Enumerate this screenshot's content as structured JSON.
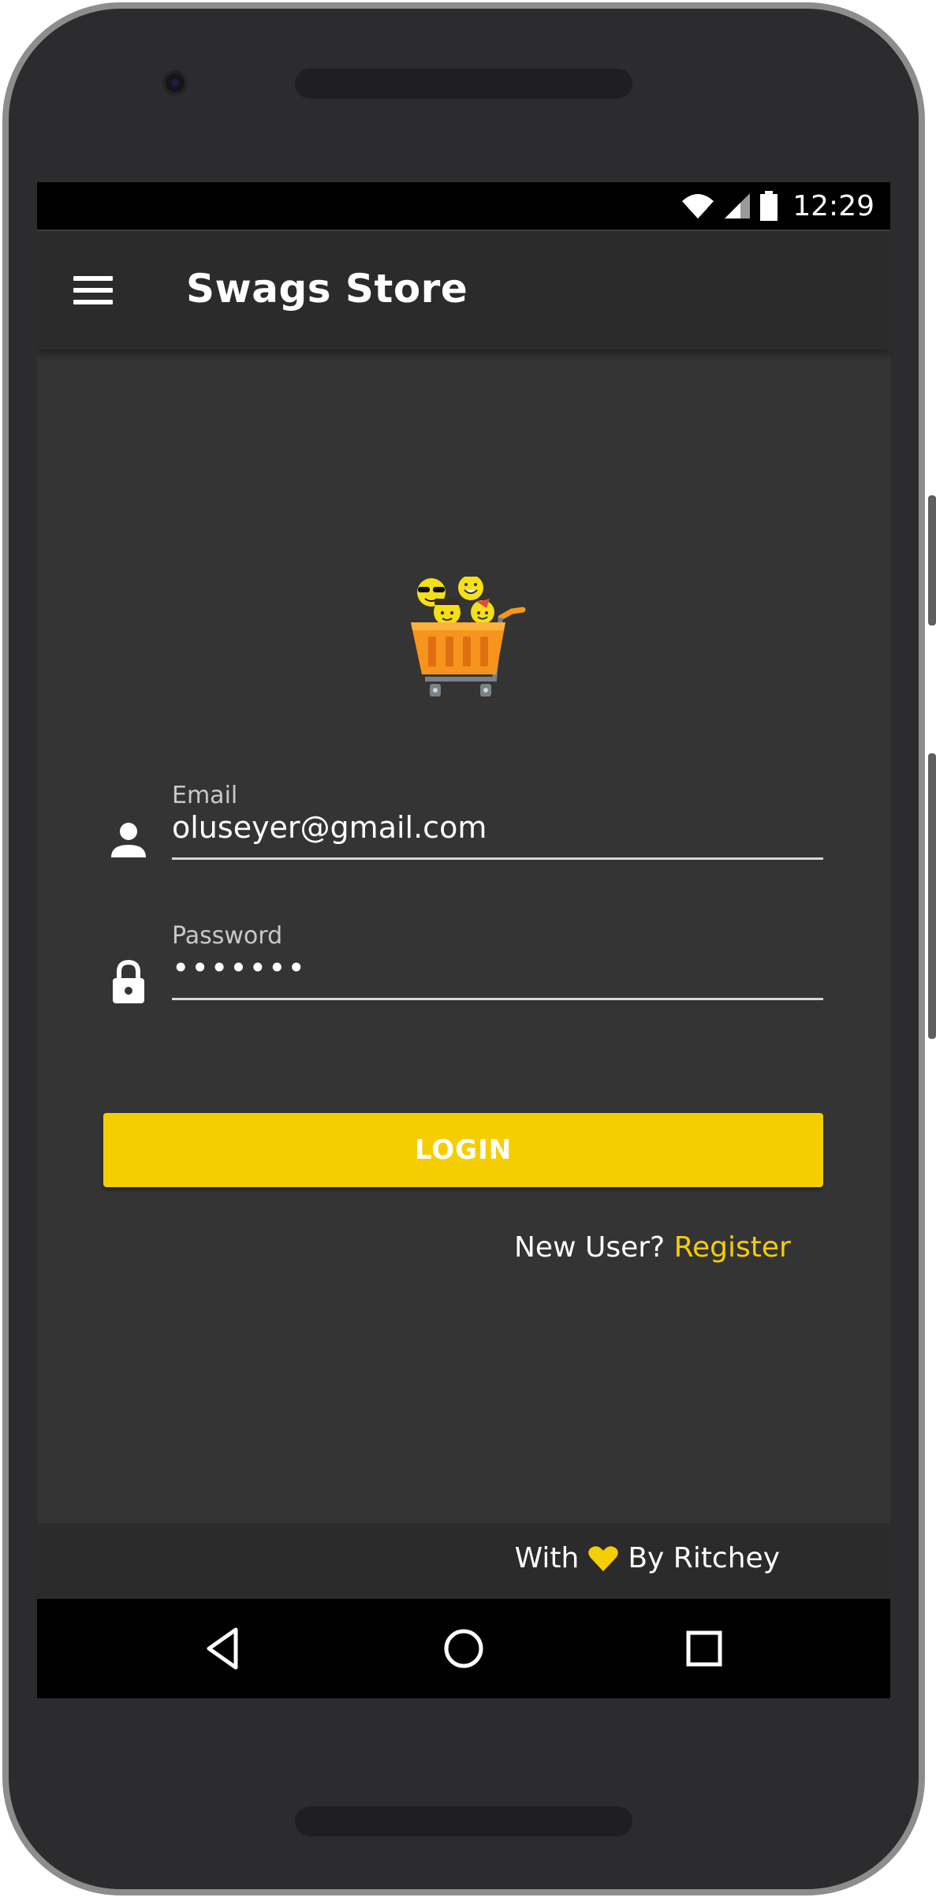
{
  "status_bar": {
    "time": "12:29",
    "icons": [
      "wifi-icon",
      "cellular-signal-icon",
      "battery-icon"
    ]
  },
  "app_bar": {
    "title": "Swags Store",
    "menu_icon": "hamburger-menu-icon"
  },
  "logo": {
    "icon": "shopping-cart-emoji-logo"
  },
  "login_form": {
    "email": {
      "label": "Email",
      "value": "oluseyer@gmail.com",
      "icon": "person-icon"
    },
    "password": {
      "label": "Password",
      "value": "•••••••",
      "icon": "lock-icon"
    },
    "login_button": "LOGIN"
  },
  "register": {
    "prompt": "New User?",
    "link": "Register"
  },
  "footer": {
    "prefix": "With",
    "icon": "heart-icon",
    "suffix": "By Ritchey"
  },
  "nav_bar": {
    "buttons": [
      "back-icon",
      "home-icon",
      "recents-icon"
    ]
  },
  "colors": {
    "accent": "#f5ce02",
    "background": "#343434",
    "app_bar": "#2b2b2b",
    "text": "#ffffff"
  }
}
